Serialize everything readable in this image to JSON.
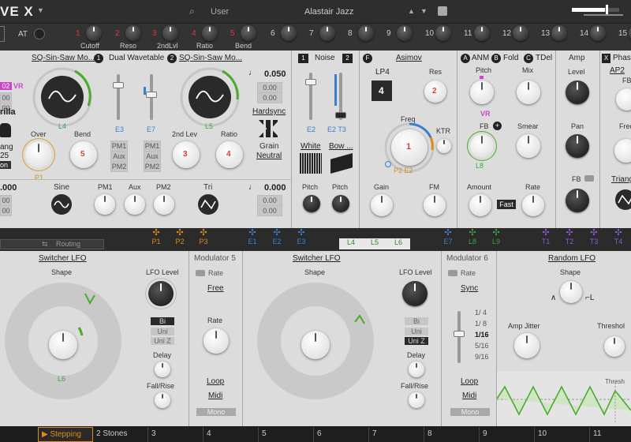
{
  "topbar": {
    "app_title": "VE X",
    "search_label": "User",
    "preset_name": "Alastair Jazz"
  },
  "macro_row": {
    "at_label": "AT",
    "macros": [
      {
        "n": "1",
        "label": "Cutoff"
      },
      {
        "n": "2",
        "label": "Reso"
      },
      {
        "n": "3",
        "label": "2ndLvl"
      },
      {
        "n": "4",
        "label": "Ratio"
      },
      {
        "n": "5",
        "label": "Bend"
      },
      {
        "n": "6",
        "label": ""
      },
      {
        "n": "7",
        "label": ""
      },
      {
        "n": "8",
        "label": ""
      },
      {
        "n": "9",
        "label": ""
      },
      {
        "n": "10",
        "label": ""
      },
      {
        "n": "11",
        "label": ""
      },
      {
        "n": "12",
        "label": ""
      },
      {
        "n": "13",
        "label": ""
      },
      {
        "n": "14",
        "label": ""
      },
      {
        "n": "15",
        "label": ""
      }
    ]
  },
  "osc1": {
    "wave_name": "SQ-Sin-Saw Mo...",
    "num": "1",
    "mode": "Dual Wavetable",
    "mod_label": "L4",
    "slider_mod": "E3",
    "left_label": "rilla",
    "left_val1": "02",
    "left_vr": "VR",
    "left_val2": "00",
    "left_val3": "00",
    "left_word1": "ang",
    "left_word2": "25",
    "left_word3": "on",
    "over_label": "Over",
    "over_mod": "P1",
    "bend_label": "Bend",
    "bend_mod": "5",
    "pm1": "PM1",
    "aux": "Aux",
    "pm2": "PM2",
    "sub_val": ".000",
    "sub_val2": "00",
    "sub_val3": "00",
    "sine_label": "Sine",
    "pm1_label": "PM1",
    "aux_label": "Aux",
    "pm2_label": "PM2"
  },
  "osc2": {
    "wave_name": "SQ-Sin-Saw Mo...",
    "num": "2",
    "slider_mod": "E7",
    "mod_label": "L5",
    "tune_val": "0.050",
    "tune2": "0.00",
    "tune3": "0.00",
    "hardsync": "Hardsync",
    "grain_label": "Grain",
    "neutral_label": "Neutral",
    "second_lev": "2nd Lev",
    "second_mod": "3",
    "ratio_label": "Ratio",
    "ratio_mod": "4",
    "pm1": "PM1",
    "aux": "Aux",
    "pm2": "PM2",
    "tri_label": "Tri",
    "sub_val": "0.000",
    "sub_val2": "0.00",
    "sub_val3": "0.00"
  },
  "noise": {
    "b1": "1",
    "title": "Noise",
    "b2": "2",
    "mod1": "E2",
    "mod2": "E2 T3",
    "white": "White",
    "bow": "Bow ...",
    "pitch1": "Pitch",
    "pitch2": "Pitch"
  },
  "filter": {
    "badge": "F",
    "title": "Asimov",
    "type": "LP4",
    "type_num": "4",
    "res_label": "Res",
    "res_mod": "2",
    "freq_label": "Freq",
    "freq_mod": "1",
    "ktr_label": "KTR",
    "mods": "P2 E2",
    "gain_label": "Gain",
    "fm_label": "FM"
  },
  "fx": {
    "a": "A",
    "anm": "ANM",
    "b": "B",
    "fold": "Fold",
    "c": "C",
    "tdel": "TDel",
    "pitch_label": "Pitch",
    "mix_label": "Mix",
    "vr": "VR",
    "fb_label": "FB",
    "smear_label": "Smear",
    "l8": "L8",
    "amount_label": "Amount",
    "rate_label": "Rate",
    "fast": "Fast"
  },
  "amp": {
    "title": "Amp",
    "level": "Level",
    "pan": "Pan",
    "fb": "FB"
  },
  "phase": {
    "badge": "X",
    "title": "Phas",
    "ap": "AP2",
    "fb": "FB",
    "freq": "Freq",
    "tri": "Triang"
  },
  "modbar": {
    "routing": "Routing",
    "tabs": [
      {
        "label": "P1",
        "color": "#e08a1e",
        "sel": false
      },
      {
        "label": "P2",
        "color": "#e08a1e",
        "sel": false
      },
      {
        "label": "P3",
        "color": "#e08a1e",
        "sel": false
      },
      {
        "label": "E1",
        "color": "#3a7fd0",
        "sel": false
      },
      {
        "label": "E2",
        "color": "#3a7fd0",
        "sel": false
      },
      {
        "label": "E3",
        "color": "#3a7fd0",
        "sel": false
      },
      {
        "label": "L4",
        "color": "#3aa53a",
        "sel": true
      },
      {
        "label": "L5",
        "color": "#3aa53a",
        "sel": true
      },
      {
        "label": "L6",
        "color": "#3aa53a",
        "sel": true
      },
      {
        "label": "E7",
        "color": "#3a7fd0",
        "sel": false
      },
      {
        "label": "L8",
        "color": "#3aa53a",
        "sel": false
      },
      {
        "label": "L9",
        "color": "#3aa53a",
        "sel": false
      },
      {
        "label": "T1",
        "color": "#8a5bd6",
        "sel": false
      },
      {
        "label": "T2",
        "color": "#8a5bd6",
        "sel": false
      },
      {
        "label": "T3",
        "color": "#8a5bd6",
        "sel": false
      },
      {
        "label": "T4",
        "color": "#8a5bd6",
        "sel": false
      }
    ]
  },
  "lfo1": {
    "title": "Switcher LFO",
    "shape": "Shape",
    "lfo_level": "LFO Level",
    "bi": "Bi",
    "uni": "Uni",
    "uniz": "Uni Z",
    "delay": "Delay",
    "fall": "Fall/Rise",
    "name": "L6"
  },
  "mod5": {
    "title": "Modulator 5",
    "rate_label": "Rate",
    "free": "Free",
    "rate": "Rate",
    "loop": "Loop",
    "midi": "Midi",
    "mono": "Mono"
  },
  "lfo2": {
    "title": "Switcher LFO",
    "shape": "Shape",
    "lfo_level": "LFO Level",
    "bi": "Bi",
    "uni": "Uni",
    "uniz": "Uni Z",
    "delay": "Delay",
    "fall": "Fall/Rise"
  },
  "mod6": {
    "title": "Modulator 6",
    "rate_label": "Rate",
    "sync": "Sync",
    "divs": [
      "1/ 4",
      "1/ 8",
      "1/16",
      "5/16",
      "9/16"
    ],
    "loop": "Loop",
    "midi": "Midi",
    "mono": "Mono"
  },
  "rlfo": {
    "title": "Random LFO",
    "shape": "Shape",
    "amp_jitter": "Amp Jitter",
    "threshold": "Threshol",
    "thresh": "Thresh"
  },
  "bottom": {
    "tabs": [
      "Stepping",
      "2  Stones",
      "3",
      "4",
      "5",
      "6",
      "7",
      "8",
      "9",
      "10",
      "11"
    ]
  }
}
